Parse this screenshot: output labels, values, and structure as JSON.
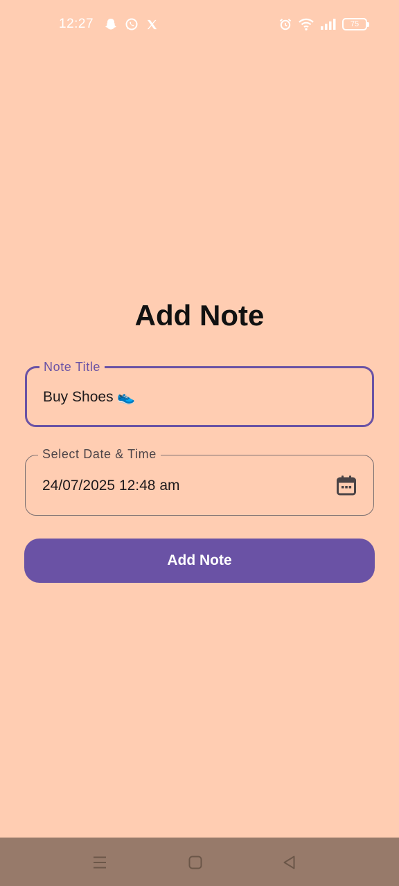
{
  "status_bar": {
    "time": "12:27",
    "battery_level": "75",
    "icons": [
      "snapchat-icon",
      "whatsapp-icon",
      "x-icon",
      "alarm-icon",
      "wifi-icon",
      "signal-icon",
      "battery-icon"
    ]
  },
  "form": {
    "title": "Add Note",
    "note_title_field": {
      "label": "Note Title",
      "value": "Buy Shoes 👟"
    },
    "date_field": {
      "label": "Select Date & Time",
      "value": "24/07/2025 12:48 am",
      "icon": "calendar-icon"
    },
    "submit_label": "Add Note"
  },
  "nav_bar": {
    "icons": [
      "menu-icon",
      "home-icon",
      "back-icon"
    ]
  },
  "colors": {
    "background": "#FFCDB2",
    "accent": "#6A52A5",
    "nav_bar": "#977A6A"
  }
}
